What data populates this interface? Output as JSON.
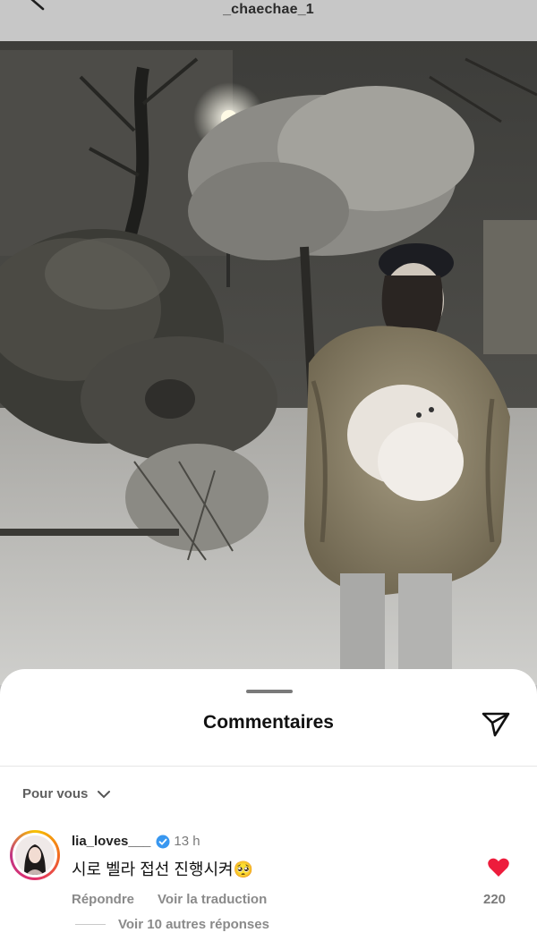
{
  "header": {
    "username": "_chaechae_1"
  },
  "comments_sheet": {
    "title": "Commentaires",
    "filter_label": "Pour vous",
    "comment": {
      "username": "lia_loves___",
      "verified": true,
      "time": "13 h",
      "text": "시로 벨라 접선 진행시켜🥺",
      "reply_label": "Répondre",
      "translate_label": "Voir la traduction",
      "likes": "220",
      "view_replies": "Voir 10 autres réponses"
    }
  },
  "colors": {
    "heart": "#ed1c3c",
    "verified": "#3897f0"
  },
  "icons": [
    "back-arrow-icon",
    "share-icon",
    "chevron-down-icon",
    "verified-badge-icon",
    "heart-icon"
  ]
}
